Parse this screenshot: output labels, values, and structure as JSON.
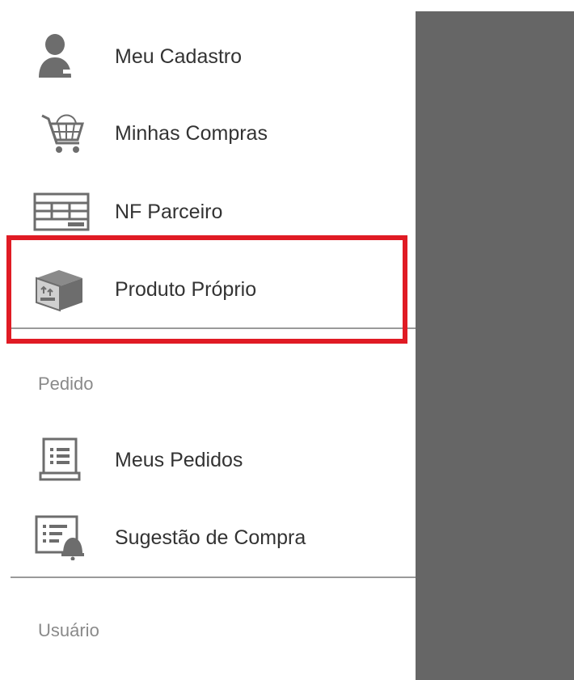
{
  "menu": {
    "items": [
      {
        "label": "Meu Cadastro",
        "icon": "user-icon"
      },
      {
        "label": "Minhas Compras",
        "icon": "shopping-cart-icon"
      },
      {
        "label": "NF Parceiro",
        "icon": "invoice-icon"
      },
      {
        "label": "Produto Próprio",
        "icon": "box-icon"
      }
    ]
  },
  "pedido": {
    "header": "Pedido",
    "items": [
      {
        "label": "Meus Pedidos",
        "icon": "order-list-icon"
      },
      {
        "label": "Sugestão de Compra",
        "icon": "purchase-suggestion-icon"
      }
    ]
  },
  "usuario": {
    "header": "Usuário"
  },
  "colors": {
    "highlight": "#e01b24",
    "overlay": "#666666",
    "icon": "#6d6d6d",
    "text": "#333333"
  }
}
